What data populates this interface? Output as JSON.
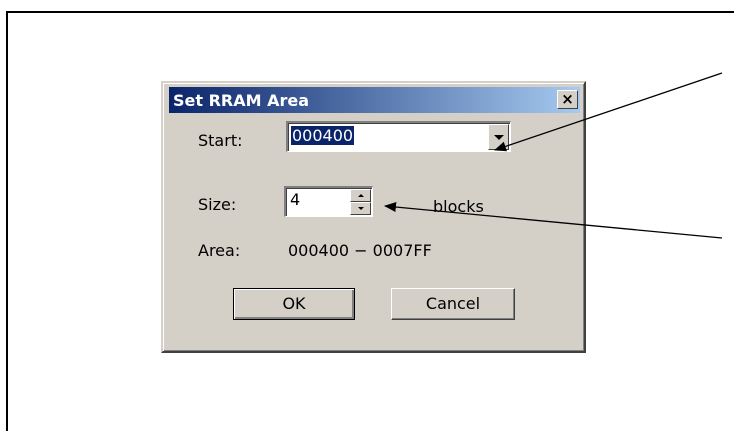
{
  "dialog": {
    "title": "Set RRAM Area",
    "close_label": "×",
    "start_label": "Start:",
    "start_value": "000400",
    "size_label": "Size:",
    "size_value": "4",
    "size_unit": "blocks",
    "area_label": "Area:",
    "area_value": "000400 − 0007FF",
    "ok_label": "OK",
    "cancel_label": "Cancel"
  },
  "icons": {
    "close": "close-icon",
    "dropdown": "chevron-down-icon",
    "spin_up": "spin-up-icon",
    "spin_down": "spin-down-icon"
  },
  "colors": {
    "titlebar_start": "#0a246a",
    "titlebar_end": "#a6caf0",
    "dialog_face": "#d4d0c8",
    "selection": "#0a246a"
  }
}
